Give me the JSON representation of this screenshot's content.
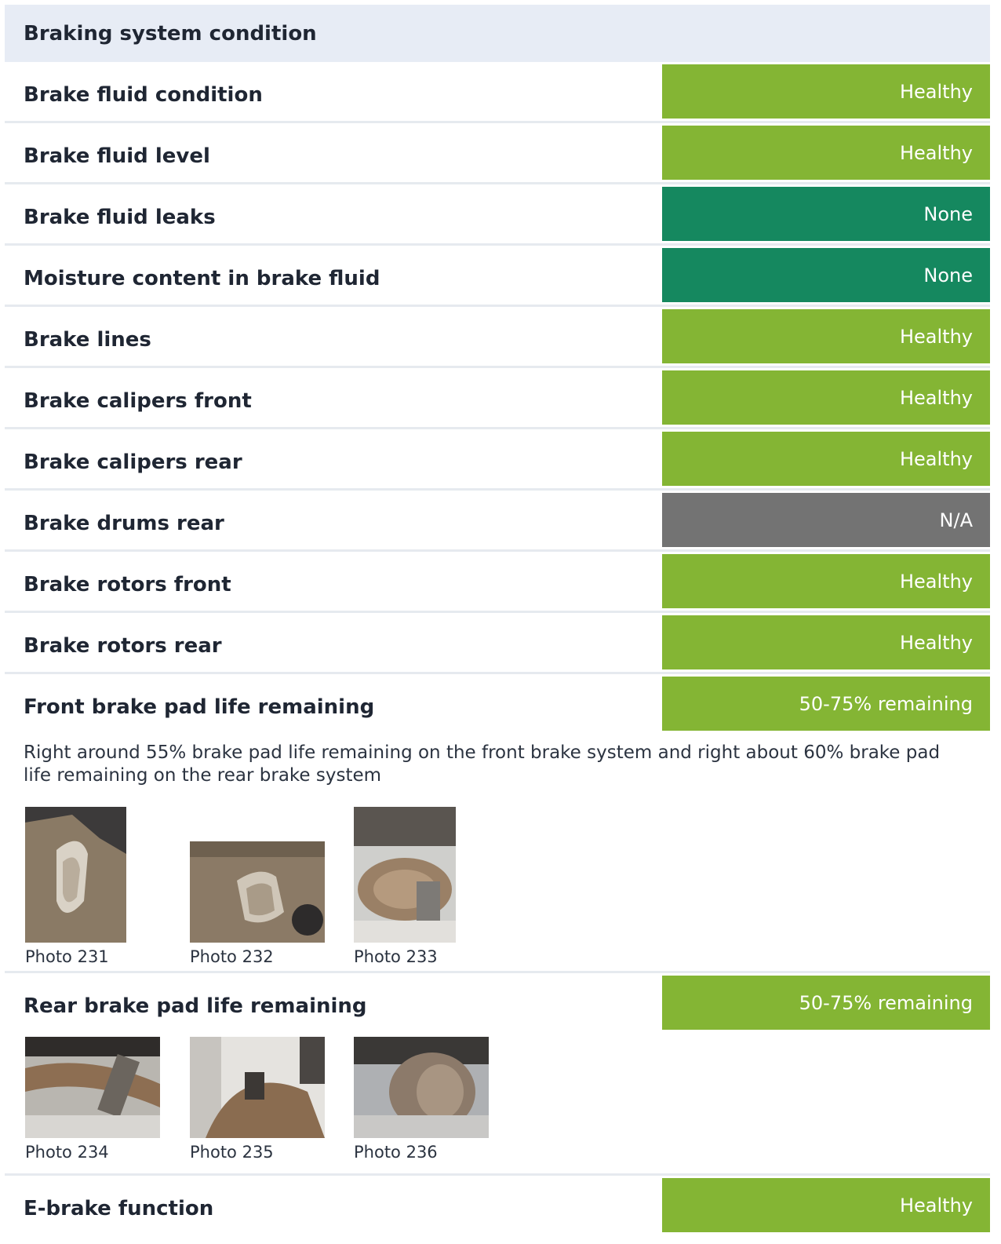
{
  "section_title": "Braking system condition",
  "colors": {
    "healthy": "#84b534",
    "none": "#15885f",
    "na": "#737373",
    "header_bg": "#e7ecf5"
  },
  "items": [
    {
      "label": "Brake fluid condition",
      "status": "Healthy",
      "color": "#84b534"
    },
    {
      "label": "Brake fluid level",
      "status": "Healthy",
      "color": "#84b534"
    },
    {
      "label": "Brake fluid leaks",
      "status": "None",
      "color": "#15885f"
    },
    {
      "label": "Moisture content in brake fluid",
      "status": "None",
      "color": "#15885f"
    },
    {
      "label": "Brake lines",
      "status": "Healthy",
      "color": "#84b534"
    },
    {
      "label": "Brake calipers front",
      "status": "Healthy",
      "color": "#84b534"
    },
    {
      "label": "Brake calipers rear",
      "status": "Healthy",
      "color": "#84b534"
    },
    {
      "label": "Brake drums rear",
      "status": "N/A",
      "color": "#737373"
    },
    {
      "label": "Brake rotors front",
      "status": "Healthy",
      "color": "#84b534"
    },
    {
      "label": "Brake rotors rear",
      "status": "Healthy",
      "color": "#84b534"
    }
  ],
  "front_pads": {
    "label": "Front brake pad life remaining",
    "status": "50-75% remaining",
    "color": "#84b534",
    "note": "Right around 55% brake pad life remaining on the front brake system and right about 60% brake pad life remaining on the rear brake system",
    "photos": [
      {
        "caption": "Photo 231"
      },
      {
        "caption": "Photo 232"
      },
      {
        "caption": "Photo 233"
      }
    ]
  },
  "rear_pads": {
    "label": "Rear brake pad life remaining",
    "status": "50-75% remaining",
    "color": "#84b534",
    "photos": [
      {
        "caption": "Photo 234"
      },
      {
        "caption": "Photo 235"
      },
      {
        "caption": "Photo 236"
      }
    ]
  },
  "ebrake": {
    "label": "E-brake function",
    "status": "Healthy",
    "color": "#84b534"
  }
}
